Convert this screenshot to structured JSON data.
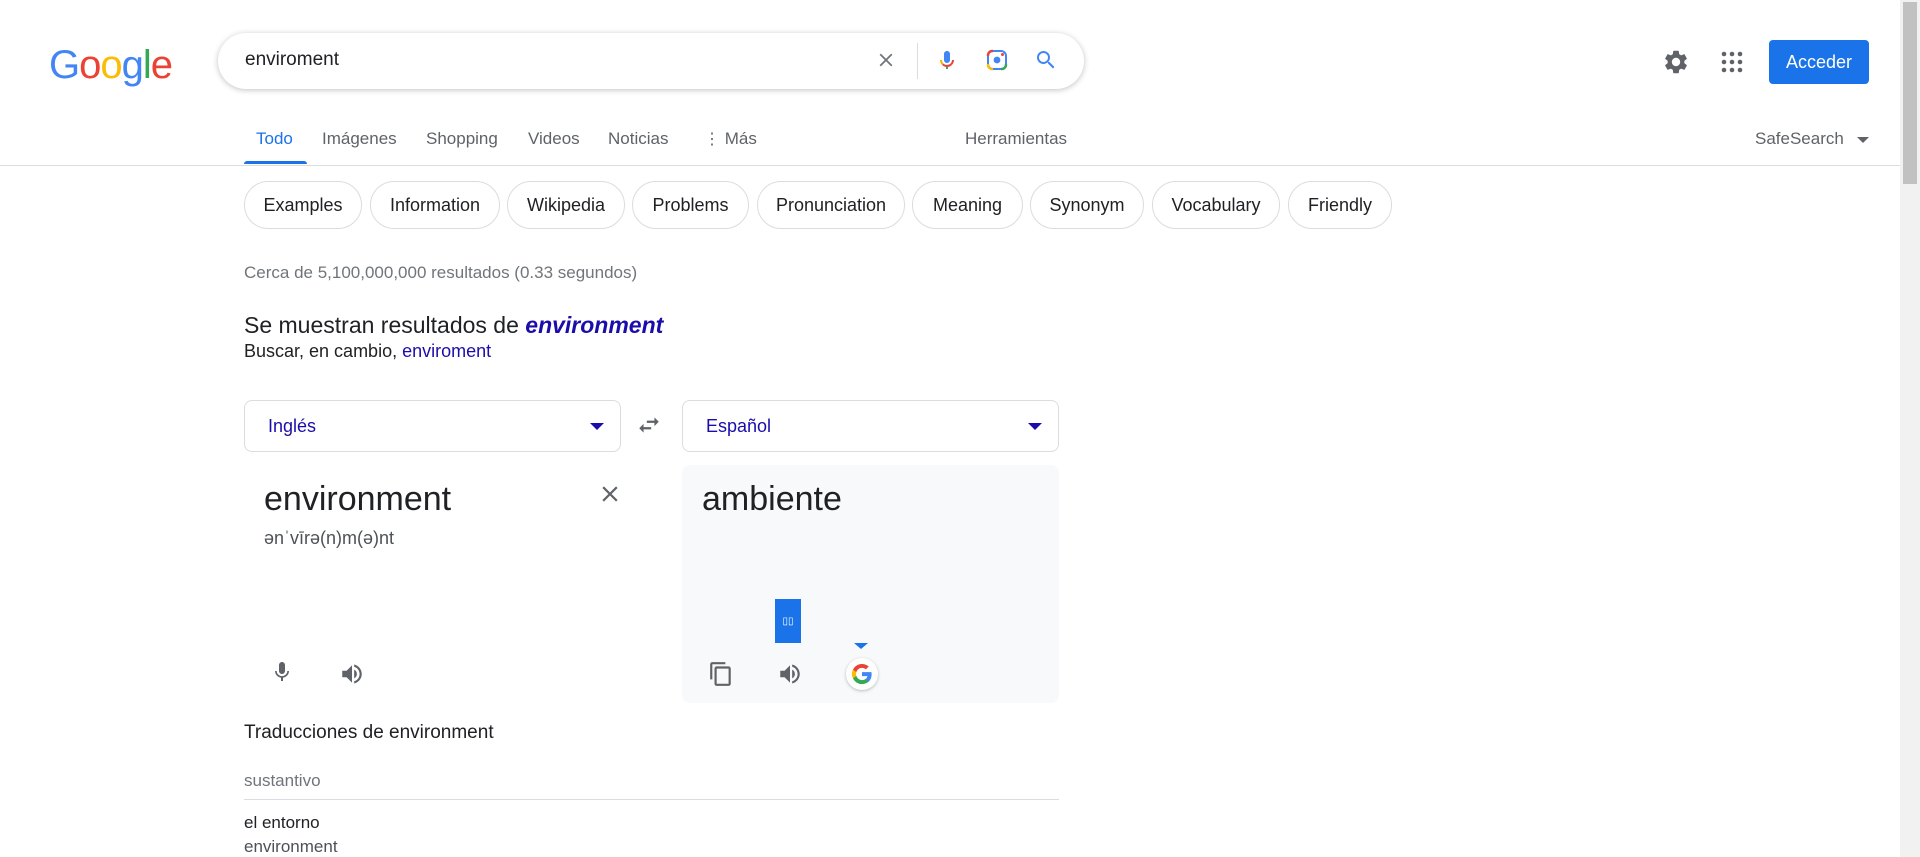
{
  "logo": {
    "letters": [
      "G",
      "o",
      "o",
      "g",
      "l",
      "e"
    ],
    "colors": [
      "#4285f4",
      "#ea4335",
      "#fbbc05",
      "#4285f4",
      "#34a853",
      "#ea4335"
    ]
  },
  "search": {
    "value": "enviroment"
  },
  "header": {
    "signin_label": "Acceder"
  },
  "tabs": [
    {
      "label": "Todo",
      "active": true
    },
    {
      "label": "Imágenes"
    },
    {
      "label": "Shopping"
    },
    {
      "label": "Videos"
    },
    {
      "label": "Noticias"
    },
    {
      "label": "Más"
    },
    {
      "label": "Herramientas"
    }
  ],
  "safesearch": "SafeSearch",
  "chips": [
    "Examples",
    "Information",
    "Wikipedia",
    "Problems",
    "Pronunciation",
    "Meaning",
    "Synonym",
    "Vocabulary",
    "Friendly"
  ],
  "results": {
    "stats": "Cerca de 5,100,000,000 resultados (0.33 segundos)",
    "showing_prefix": "Se muestran resultados de ",
    "showing_term": "environment",
    "instead_prefix": "Buscar, en cambio, ",
    "instead_term": "enviroment"
  },
  "translator": {
    "source_lang": "Inglés",
    "target_lang": "Español",
    "source_word": "environment",
    "phonetic": "ənˈvīrə(n)m(ə)nt",
    "target_word": "ambiente"
  },
  "translations": {
    "heading": "Traducciones de environment",
    "part_of_speech": "sustantivo",
    "entries": [
      {
        "word": "el entorno",
        "back": "environment"
      }
    ]
  },
  "colors": {
    "accent": "#1a73e8",
    "link": "#1a0dab"
  }
}
